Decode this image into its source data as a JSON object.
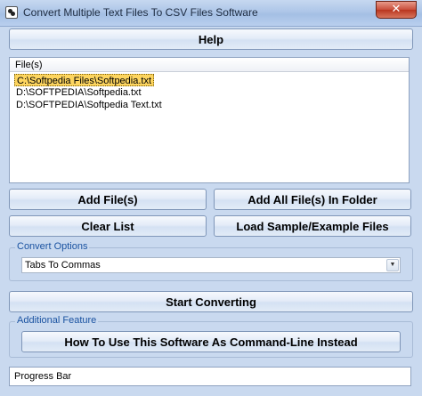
{
  "window": {
    "title": "Convert Multiple Text Files To CSV Files Software",
    "close_glyph": "✕"
  },
  "help_button": "Help",
  "file_list": {
    "header": "File(s)",
    "items": [
      "C:\\Softpedia Files\\Softpedia.txt",
      "D:\\SOFTPEDIA\\Softpedia.txt",
      "D:\\SOFTPEDIA\\Softpedia Text.txt"
    ],
    "selected_index": 0
  },
  "buttons": {
    "add_files": "Add File(s)",
    "add_all_in_folder": "Add All File(s) In Folder",
    "clear_list": "Clear List",
    "load_sample": "Load Sample/Example Files",
    "start_converting": "Start Converting",
    "command_line": "How To Use This Software As Command-Line Instead"
  },
  "convert_options": {
    "label": "Convert Options",
    "selected": "Tabs To Commas",
    "arrow_glyph": "▼"
  },
  "additional_feature": {
    "label": "Additional Feature"
  },
  "progress_bar": {
    "text": "Progress Bar"
  }
}
